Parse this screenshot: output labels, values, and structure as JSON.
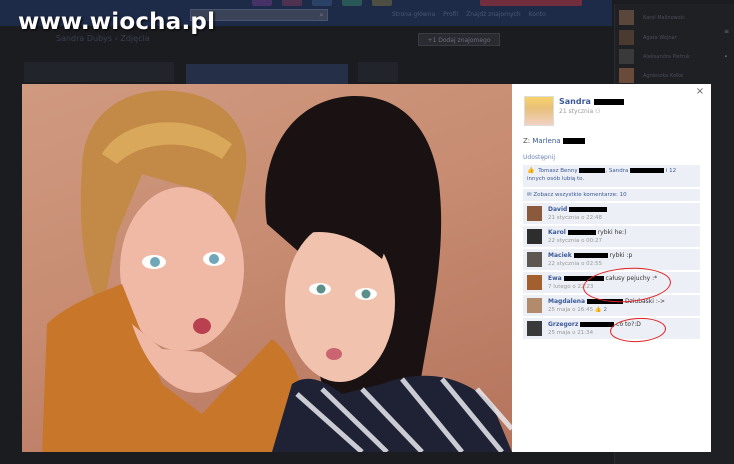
{
  "watermark": "www.wiocha.pl",
  "background_page": {
    "top_links": [
      "Strona główna",
      "Profil",
      "Znajdź znajomych",
      "Konto"
    ],
    "heading": "Sandra Dubys › Zdjęcia",
    "add_friend_button": "+1 Dodaj znajomego"
  },
  "right_panel": {
    "friends": [
      "Karol Malinowski",
      "Agata Wojnar",
      "Aleksandra Pietruk",
      "Agnieszka Kolke"
    ]
  },
  "photo": {
    "description_icon": "two-girls-photo"
  },
  "sidebar": {
    "close_icon": "×",
    "owner_name": "Sandra",
    "owner_date": "21 stycznia",
    "from_label": "Z:",
    "from_name": "Marlena",
    "share_label": "Udostępnij",
    "likes_prefix": "Tomasz Benny",
    "likes_middle": "Sandra",
    "likes_suffix": "i 12 innych osób lubią to.",
    "all_comments": "Zobacz wszystkie komentarze: 10",
    "comments": [
      {
        "author": "David",
        "text": "",
        "meta": "21 stycznia o 22:48",
        "like": ""
      },
      {
        "author": "Karol",
        "text": "rybki he:)",
        "meta": "22 stycznia o 00:27",
        "like": ""
      },
      {
        "author": "Maciek",
        "text": "rybki :p",
        "meta": "22 stycznia o 02:55",
        "like": ""
      },
      {
        "author": "Ewa",
        "text": "całusy pejuchy :*",
        "meta": "7 lutego o 22:23",
        "like": ""
      },
      {
        "author": "Magdalena",
        "text": "Dziubaski :->",
        "meta": "25 maja o 16:45",
        "like": "2"
      },
      {
        "author": "Grzegorz",
        "text": "co to?:D",
        "meta": "25 maja o 21:34",
        "like": ""
      }
    ]
  },
  "colors": {
    "fb_blue": "#3b5998",
    "panel_bg": "#eceff5",
    "annotation": "#e22222"
  }
}
